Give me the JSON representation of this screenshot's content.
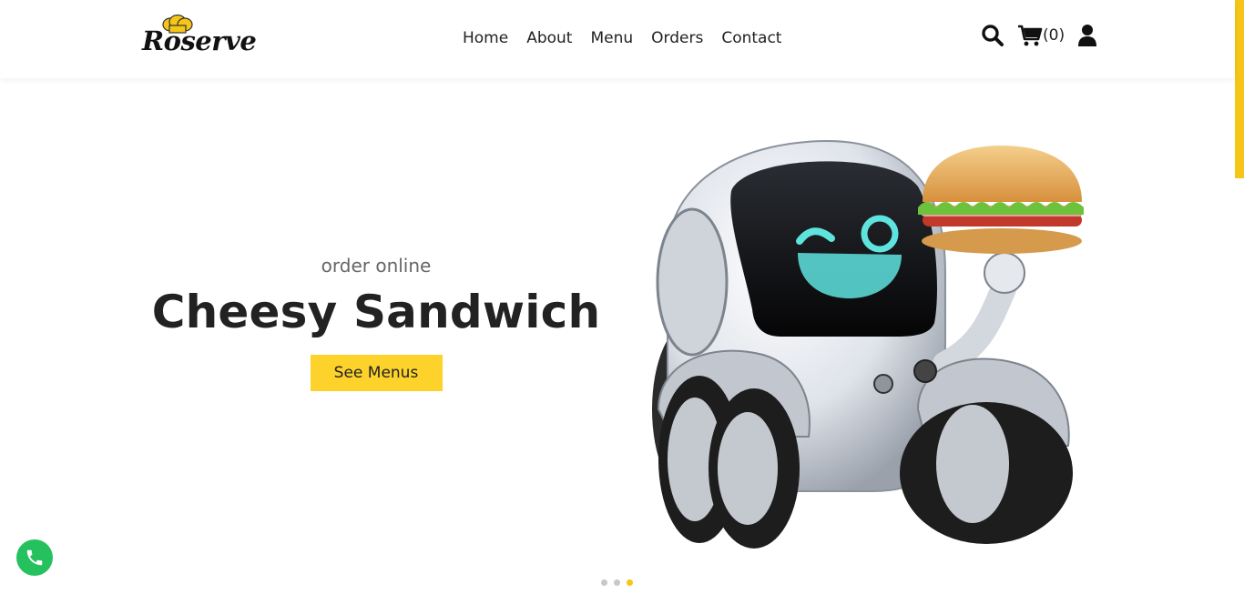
{
  "brand": {
    "name": "Roserve",
    "logo_icon": "chef-hat-icon",
    "accent": "#fcd22b"
  },
  "nav": {
    "items": [
      {
        "label": "Home"
      },
      {
        "label": "About"
      },
      {
        "label": "Menu"
      },
      {
        "label": "Orders"
      },
      {
        "label": "Contact"
      }
    ]
  },
  "toolbar": {
    "search_icon": "search-icon",
    "cart_icon": "cart-icon",
    "cart_count": "(0)",
    "user_icon": "user-icon"
  },
  "hero": {
    "subtitle": "order online",
    "title": "Cheesy Sandwich",
    "cta_label": "See Menus",
    "image": "robot-holding-burger-illustration"
  },
  "carousel": {
    "slides": 3,
    "active_slide": 3
  },
  "floating": {
    "phone_icon": "phone-icon",
    "color": "#25c15f"
  }
}
